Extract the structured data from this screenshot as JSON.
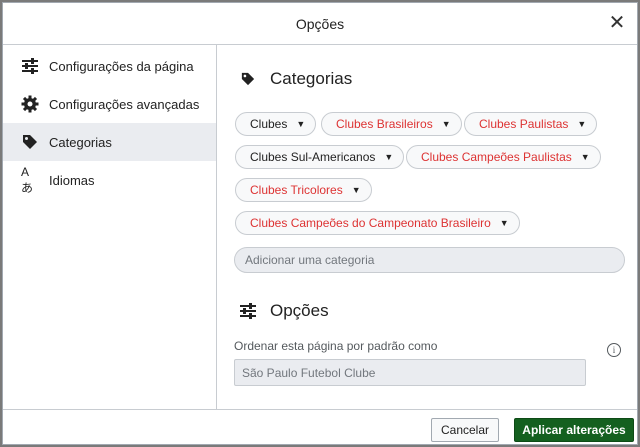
{
  "dialog": {
    "title": "Opções"
  },
  "sidebar": {
    "items": [
      {
        "label": "Configurações da página",
        "icon": "settings-sliders-icon"
      },
      {
        "label": "Configurações avançadas",
        "icon": "gear-icon"
      },
      {
        "label": "Categorias",
        "icon": "tag-icon",
        "active": true
      },
      {
        "label": "Idiomas",
        "icon": "language-icon",
        "glyph": "Aあ"
      }
    ]
  },
  "categories": {
    "heading": "Categorias",
    "chips": [
      {
        "label": "Clubes",
        "red": false
      },
      {
        "label": "Clubes Brasileiros",
        "red": true
      },
      {
        "label": "Clubes Paulistas",
        "red": true
      },
      {
        "label": "Clubes Sul-Americanos",
        "red": false
      },
      {
        "label": "Clubes Campeões Paulistas",
        "red": true
      },
      {
        "label": "Clubes Tricolores",
        "red": true
      },
      {
        "label": "Clubes Campeões do Campeonato Brasileiro",
        "red": true
      }
    ],
    "add_placeholder": "Adicionar uma categoria",
    "caret": "▼"
  },
  "options": {
    "heading": "Opções",
    "sort_label": "Ordenar esta página por padrão como",
    "sort_value": "São Paulo Futebol Clube",
    "info_glyph": "i"
  },
  "footer": {
    "cancel_label": "Cancelar",
    "apply_label": "Aplicar alterações"
  },
  "colors": {
    "red_link": "#dd3333",
    "apply_button": "#14601f",
    "active_nav": "#eaecf0"
  },
  "close_glyph": "✕"
}
